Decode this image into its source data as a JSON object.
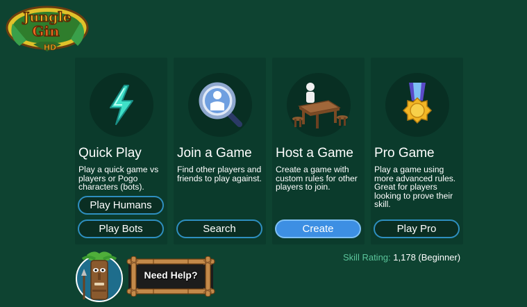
{
  "logo": {
    "text_line1": "Jungle",
    "text_line2": "Gin",
    "text_line3": "HD"
  },
  "cards": [
    {
      "icon": "lightning-icon",
      "title": "Quick Play",
      "description": "Play a quick game vs players or Pogo characters (bots).",
      "buttons": [
        "Play Humans",
        "Play Bots"
      ]
    },
    {
      "icon": "magnifier-person-icon",
      "title": "Join a Game",
      "description": "Find other players and friends to play against.",
      "buttons": [
        "Search"
      ]
    },
    {
      "icon": "table-player-icon",
      "title": "Host a Game",
      "description": "Create a game with custom rules for other players to join.",
      "buttons": [
        "Create"
      ]
    },
    {
      "icon": "medal-icon",
      "title": "Pro Game",
      "description": "Play a game using more advanced rules. Great for players looking to prove their skill.",
      "buttons": [
        "Play Pro"
      ]
    }
  ],
  "help": {
    "label": "Need Help?"
  },
  "skill": {
    "label": "Skill Rating:",
    "value": "1,178 (Beginner)"
  },
  "colors": {
    "background": "#0e4331",
    "card": "#0b3b2c",
    "button_border": "#2e8fc0",
    "button_primary": "#3d8fe3",
    "skill_label": "#5ac49a"
  }
}
